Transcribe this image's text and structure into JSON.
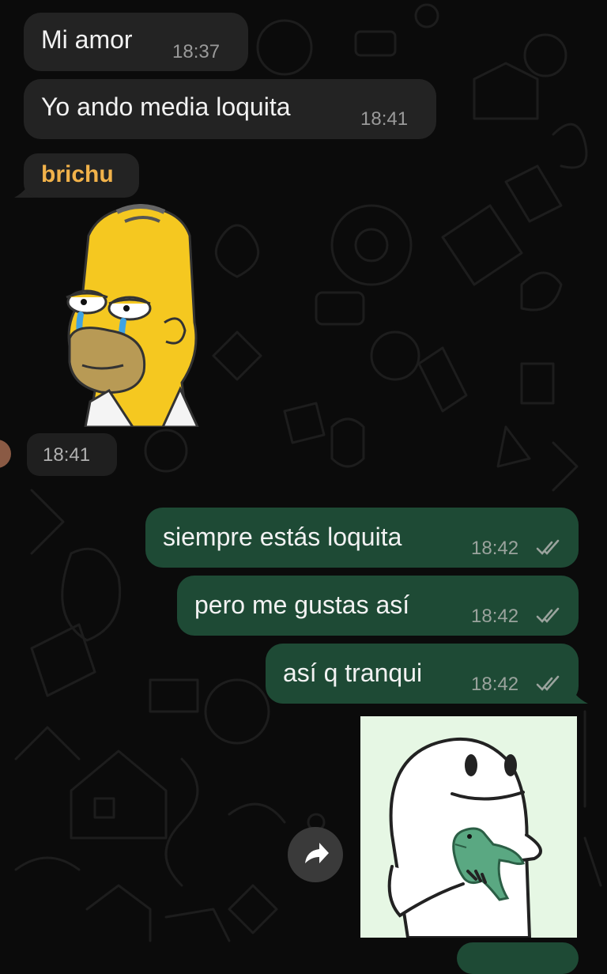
{
  "chat": {
    "messages": [
      {
        "direction": "incoming",
        "text": "Mi amor",
        "time": "18:37"
      },
      {
        "direction": "incoming",
        "text": "Yo ando media loquita",
        "time": "18:41"
      },
      {
        "direction": "incoming",
        "sender": "brichu",
        "type": "sticker",
        "sticker": "homer-crying-sticker",
        "time": "18:41"
      },
      {
        "direction": "outgoing",
        "text": "siempre estás loquita",
        "time": "18:42",
        "status": "read"
      },
      {
        "direction": "outgoing",
        "text": "pero me gustas así",
        "time": "18:42",
        "status": "read"
      },
      {
        "direction": "outgoing",
        "text": "así q tranqui",
        "time": "18:42",
        "status": "read"
      },
      {
        "direction": "outgoing",
        "type": "sticker",
        "sticker": "flork-holding-dinosaur-sticker"
      }
    ]
  },
  "colors": {
    "background": "#0b0b0b",
    "incoming_bubble": "#232323",
    "outgoing_bubble": "#1e4a35",
    "sender_name": "#f1b24a"
  },
  "icons": {
    "forward": "forward-arrow-icon",
    "read_receipt": "double-check-icon"
  }
}
